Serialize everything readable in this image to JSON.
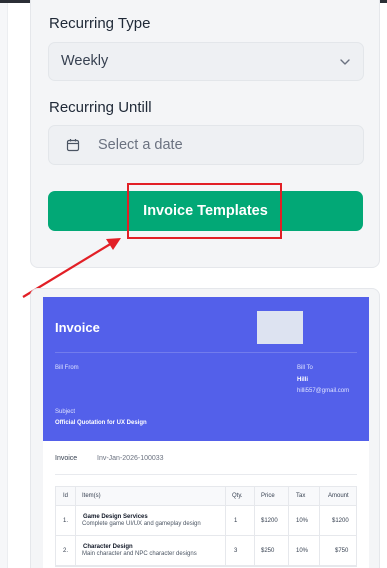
{
  "form": {
    "recurring_type_label": "Recurring Type",
    "recurring_type_value": "Weekly",
    "recurring_until_label": "Recurring Untill",
    "date_placeholder": "Select a date",
    "templates_button": "Invoice Templates"
  },
  "colors": {
    "accent_green": "#02a876",
    "invoice_header": "#5360ea",
    "highlight_red": "#e21f26"
  },
  "invoice": {
    "title": "Invoice",
    "bill_from_label": "Bill From",
    "bill_to_label": "Bill To",
    "bill_to_name": "Hilli",
    "bill_to_email": "hilli557@gmail.com",
    "subject_label": "Subject",
    "subject_value": "Official Quotation for UX Design",
    "number_label": "Invoice",
    "number_value": "Inv-Jan-2026-100033",
    "columns": [
      "Id",
      "Item(s)",
      "Qty.",
      "Price",
      "Tax",
      "Amount"
    ],
    "items": [
      {
        "id": "1.",
        "name": "Game Design Services",
        "desc": "Complete game UI/UX and gameplay design",
        "qty": "1",
        "price": "$1200",
        "tax": "10%",
        "amount": "$1200"
      },
      {
        "id": "2.",
        "name": "Character Design",
        "desc": "Main character and NPC character designs",
        "qty": "3",
        "price": "$250",
        "tax": "10%",
        "amount": "$750"
      }
    ]
  }
}
